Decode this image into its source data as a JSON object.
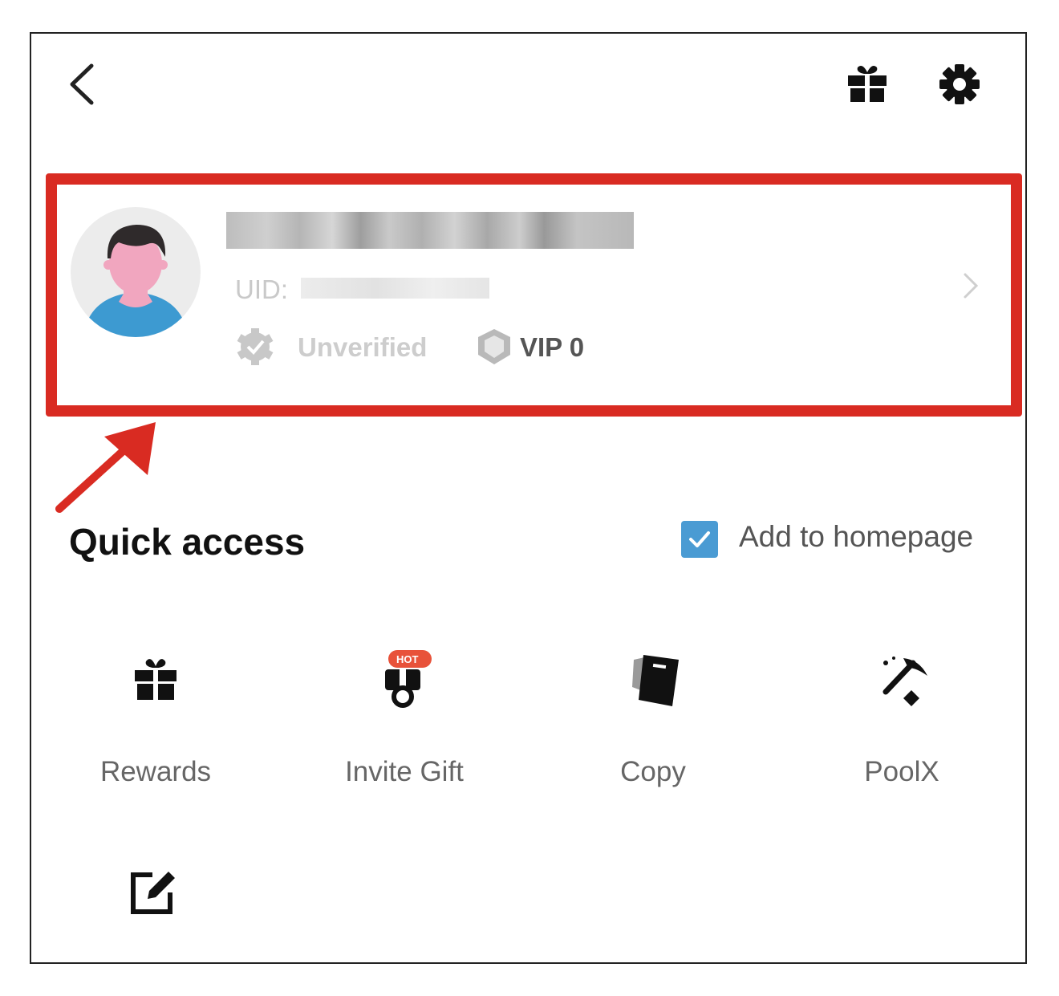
{
  "header": {
    "back_icon": "chevron-left-icon",
    "gift_icon": "gift-icon",
    "settings_icon": "gear-icon"
  },
  "profile": {
    "uid_label": "UID:",
    "verification_status": "Unverified",
    "vip_level": "VIP 0",
    "highlight_color": "#d92b22"
  },
  "quick_access": {
    "title": "Quick access",
    "add_to_homepage_label": "Add to homepage",
    "add_to_homepage_checked": true,
    "checkbox_color": "#4a9bd3",
    "items": [
      {
        "label": "Rewards",
        "icon": "gift-icon"
      },
      {
        "label": "Invite Gift",
        "icon": "invite-gift-icon",
        "badge": "HOT"
      },
      {
        "label": "Copy",
        "icon": "copy-trade-icon"
      },
      {
        "label": "PoolX",
        "icon": "pickaxe-icon"
      },
      {
        "label": "",
        "icon": "edit-icon"
      }
    ]
  }
}
